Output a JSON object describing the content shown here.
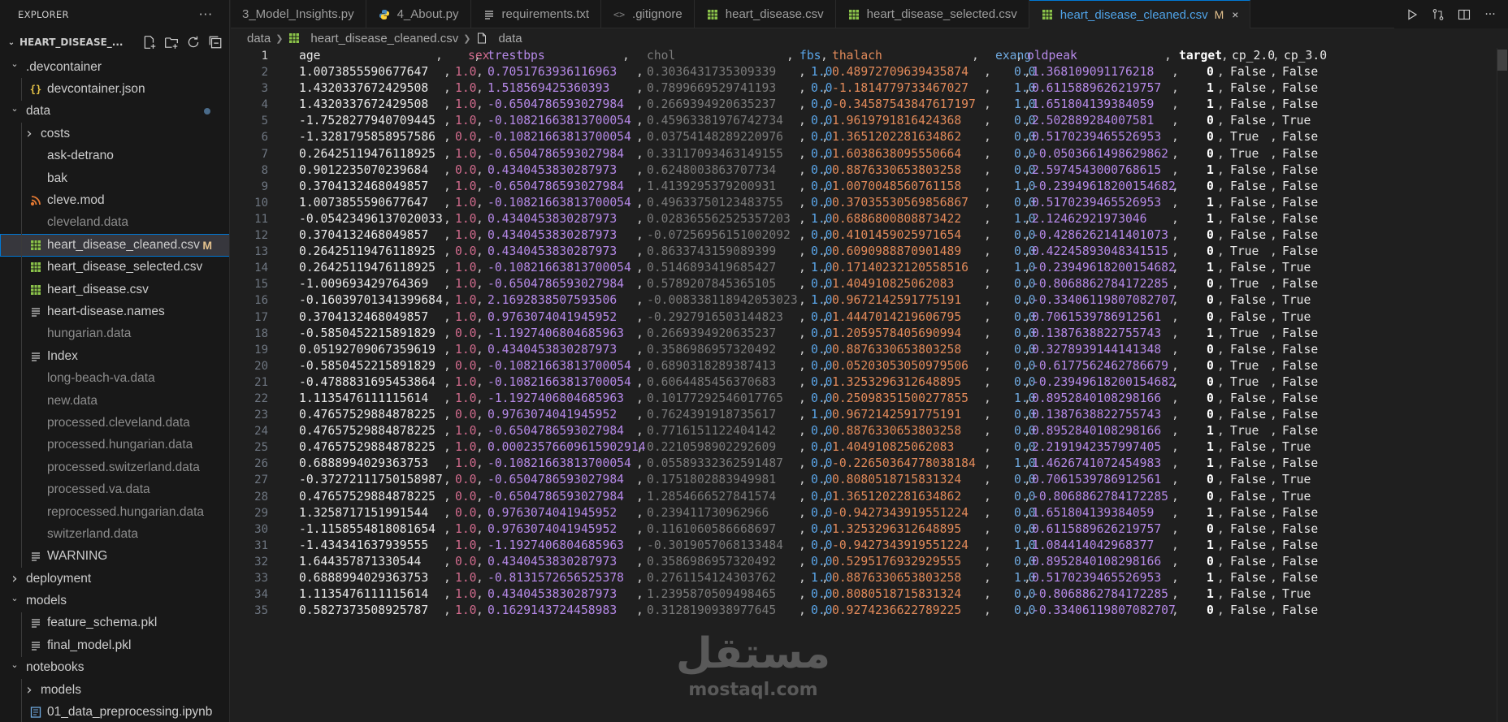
{
  "sidebar": {
    "header": "EXPLORER",
    "more": "···",
    "workspace": "HEART_DISEASE_...",
    "items": [
      {
        "label": ".devcontainer",
        "kind": "folder-open",
        "indent": 1,
        "dim": false
      },
      {
        "label": "devcontainer.json",
        "kind": "json",
        "indent": 2,
        "dim": false
      },
      {
        "label": "data",
        "kind": "folder-open",
        "indent": 1,
        "dim": false,
        "dot": true
      },
      {
        "label": "costs",
        "kind": "folder",
        "indent": 2,
        "dim": false
      },
      {
        "label": "ask-detrano",
        "kind": "file",
        "indent": 2,
        "dim": false
      },
      {
        "label": "bak",
        "kind": "file",
        "indent": 2,
        "dim": false
      },
      {
        "label": "cleve.mod",
        "kind": "rss",
        "indent": 2,
        "dim": false
      },
      {
        "label": "cleveland.data",
        "kind": "file",
        "indent": 2,
        "dim": true
      },
      {
        "label": "heart_disease_cleaned.csv",
        "kind": "csv",
        "indent": 2,
        "dim": false,
        "selected": true,
        "badge": "M"
      },
      {
        "label": "heart_disease_selected.csv",
        "kind": "csv",
        "indent": 2,
        "dim": false
      },
      {
        "label": "heart_disease.csv",
        "kind": "csv",
        "indent": 2,
        "dim": false
      },
      {
        "label": "heart-disease.names",
        "kind": "lines",
        "indent": 2,
        "dim": false
      },
      {
        "label": "hungarian.data",
        "kind": "file",
        "indent": 2,
        "dim": true
      },
      {
        "label": "Index",
        "kind": "lines",
        "indent": 2,
        "dim": false
      },
      {
        "label": "long-beach-va.data",
        "kind": "file",
        "indent": 2,
        "dim": true
      },
      {
        "label": "new.data",
        "kind": "file",
        "indent": 2,
        "dim": true
      },
      {
        "label": "processed.cleveland.data",
        "kind": "file",
        "indent": 2,
        "dim": true
      },
      {
        "label": "processed.hungarian.data",
        "kind": "file",
        "indent": 2,
        "dim": true
      },
      {
        "label": "processed.switzerland.data",
        "kind": "file",
        "indent": 2,
        "dim": true
      },
      {
        "label": "processed.va.data",
        "kind": "file",
        "indent": 2,
        "dim": true
      },
      {
        "label": "reprocessed.hungarian.data",
        "kind": "file",
        "indent": 2,
        "dim": true
      },
      {
        "label": "switzerland.data",
        "kind": "file",
        "indent": 2,
        "dim": true
      },
      {
        "label": "WARNING",
        "kind": "lines",
        "indent": 2,
        "dim": false
      },
      {
        "label": "deployment",
        "kind": "folder",
        "indent": 1,
        "dim": false
      },
      {
        "label": "models",
        "kind": "folder-open",
        "indent": 1,
        "dim": false
      },
      {
        "label": "feature_schema.pkl",
        "kind": "lines",
        "indent": 2,
        "dim": false
      },
      {
        "label": "final_model.pkl",
        "kind": "lines",
        "indent": 2,
        "dim": false
      },
      {
        "label": "notebooks",
        "kind": "folder-open",
        "indent": 1,
        "dim": false
      },
      {
        "label": "models",
        "kind": "folder",
        "indent": 2,
        "dim": false
      },
      {
        "label": "01_data_preprocessing.ipynb",
        "kind": "notebook",
        "indent": 2,
        "dim": false
      }
    ]
  },
  "tabs": [
    {
      "label": "3_Model_Insights.py",
      "kind": "none",
      "active": false
    },
    {
      "label": "4_About.py",
      "kind": "python",
      "active": false
    },
    {
      "label": "requirements.txt",
      "kind": "lines",
      "active": false
    },
    {
      "label": ".gitignore",
      "kind": "git",
      "active": false
    },
    {
      "label": "heart_disease.csv",
      "kind": "csv",
      "active": false
    },
    {
      "label": "heart_disease_selected.csv",
      "kind": "csv",
      "active": false
    },
    {
      "label": "heart_disease_cleaned.csv",
      "kind": "csv",
      "active": true,
      "modified": "M",
      "close": "×"
    }
  ],
  "breadcrumb": {
    "folder": "data",
    "file": "heart_disease_cleaned.csv",
    "symbol": "data"
  },
  "editor": {
    "current_line": 1,
    "header": [
      "age",
      "sex",
      "trestbps",
      "chol",
      "fbs",
      "thalach",
      "exang",
      "oldpeak",
      "target",
      "cp_2.0",
      "cp_3.0"
    ],
    "rows": [
      [
        "1.0073855590677647",
        "1.0",
        "0.7051763936116963",
        "0.3036431735309339",
        "1.0",
        "0.48972709639435874",
        "0.0",
        "1.368109091176218",
        "0",
        "False",
        "False"
      ],
      [
        "1.4320337672429508",
        "1.0",
        "1.518569425360393",
        "0.7899669529741193",
        "0.0",
        "-1.1814779733467027",
        "1.0",
        "0.6115889626219757",
        "1",
        "False",
        "False"
      ],
      [
        "1.4320337672429508",
        "1.0",
        "-0.6504786593027984",
        "0.2669394920635237",
        "0.0",
        "-0.34587543847617197",
        "1.0",
        "1.651804139384059",
        "1",
        "False",
        "False"
      ],
      [
        "-1.7528277940709445",
        "1.0",
        "-0.10821663813700054",
        "0.45963381976742734",
        "0.0",
        "1.9619791816424368",
        "0.0",
        "2.502889284007581",
        "0",
        "False",
        "True"
      ],
      [
        "-1.3281795858957586",
        "0.0",
        "-0.10821663813700054",
        "0.03754148289220976",
        "0.0",
        "1.3651202281634862",
        "0.0",
        "0.5170239465526953",
        "0",
        "True",
        "False"
      ],
      [
        "0.26425119476118925",
        "1.0",
        "-0.6504786593027984",
        "0.33117093463149155",
        "0.0",
        "1.6038638095550664",
        "0.0",
        "-0.0503661498629862",
        "0",
        "True",
        "False"
      ],
      [
        "0.9012235070239684",
        "0.0",
        "0.4340453830287973",
        "0.6248003863707734",
        "0.0",
        "0.8876330653803258",
        "0.0",
        "2.5974543000768615",
        "1",
        "False",
        "False"
      ],
      [
        "0.3704132468049857",
        "1.0",
        "-0.6504786593027984",
        "1.4139295379200931",
        "0.0",
        "1.0070048560761158",
        "1.0",
        "-0.23949618200154682",
        "0",
        "False",
        "False"
      ],
      [
        "1.0073855590677647",
        "1.0",
        "-0.10821663813700054",
        "0.49633750123483755",
        "0.0",
        "0.37035530569856867",
        "0.0",
        "0.5170239465526953",
        "1",
        "False",
        "False"
      ],
      [
        "-0.05423496137020033",
        "1.0",
        "0.4340453830287973",
        "0.028365562525357203",
        "1.0",
        "0.6886800808873422",
        "1.0",
        "2.12462921973046",
        "1",
        "False",
        "False"
      ],
      [
        "0.3704132468049857",
        "1.0",
        "0.4340453830287973",
        "-0.07256956151002092",
        "0.0",
        "0.4101459025971654",
        "0.0",
        "-0.4286262141401073",
        "0",
        "False",
        "False"
      ],
      [
        "0.26425119476118925",
        "0.0",
        "0.4340453830287973",
        "0.8633743159089399",
        "0.0",
        "0.6090988870901489",
        "0.0",
        "0.42245893048341515",
        "0",
        "True",
        "False"
      ],
      [
        "0.26425119476118925",
        "1.0",
        "-0.10821663813700054",
        "0.5146893419685427",
        "1.0",
        "0.17140232120558516",
        "1.0",
        "-0.23949618200154682",
        "1",
        "False",
        "True"
      ],
      [
        "-1.009693429764369",
        "1.0",
        "-0.6504786593027984",
        "0.5789207845365105",
        "0.0",
        "1.404910825062083",
        "0.0",
        "-0.8068862784172285",
        "0",
        "True",
        "False"
      ],
      [
        "-0.16039701341399684",
        "1.0",
        "2.1692838507593506",
        "-0.008338118942053023",
        "1.0",
        "0.9672142591775191",
        "0.0",
        "-0.33406119807082707",
        "0",
        "False",
        "True"
      ],
      [
        "0.3704132468049857",
        "1.0",
        "0.9763074041945952",
        "-0.2927916503144823",
        "0.0",
        "1.4447014219606795",
        "0.0",
        "0.7061539786912561",
        "0",
        "False",
        "True"
      ],
      [
        "-0.5850452215891829",
        "0.0",
        "-1.1927406804685963",
        "0.2669394920635237",
        "0.0",
        "1.2059578405690994",
        "0.0",
        "0.1387638822755743",
        "1",
        "True",
        "False"
      ],
      [
        "0.05192709067359619",
        "1.0",
        "0.4340453830287973",
        "0.3586986957320492",
        "0.0",
        "0.8876330653803258",
        "0.0",
        "0.3278939144141348",
        "0",
        "False",
        "False"
      ],
      [
        "-0.5850452215891829",
        "0.0",
        "-0.10821663813700054",
        "0.6890318289387413",
        "0.0",
        "0.05203053050979506",
        "0.0",
        "-0.6177562462786679",
        "0",
        "True",
        "False"
      ],
      [
        "-0.4788831695453864",
        "1.0",
        "-0.10821663813700054",
        "0.6064485456370683",
        "0.0",
        "1.3253296312648895",
        "0.0",
        "-0.23949618200154682",
        "0",
        "True",
        "False"
      ],
      [
        "1.1135476111115614",
        "1.0",
        "-1.1927406804685963",
        "0.10177292546017765",
        "0.0",
        "0.25098351500277855",
        "1.0",
        "0.8952840108298166",
        "0",
        "False",
        "False"
      ],
      [
        "0.47657529884878225",
        "0.0",
        "0.9763074041945952",
        "0.7624391918735617",
        "1.0",
        "0.9672142591775191",
        "0.0",
        "0.1387638822755743",
        "0",
        "False",
        "False"
      ],
      [
        "0.47657529884878225",
        "1.0",
        "-0.6504786593027984",
        "0.7716151122404142",
        "0.0",
        "0.8876330653803258",
        "0.0",
        "0.8952840108298166",
        "1",
        "True",
        "False"
      ],
      [
        "0.47657529884878225",
        "1.0",
        "0.00023576609615902914",
        "0.2210598902292609",
        "0.0",
        "1.404910825062083",
        "0.0",
        "2.2191942357997405",
        "1",
        "False",
        "True"
      ],
      [
        "0.6888994029363753",
        "1.0",
        "-0.10821663813700054",
        "0.05589332362591487",
        "0.0",
        "-0.22650364778038184",
        "1.0",
        "1.4626741072454983",
        "1",
        "False",
        "False"
      ],
      [
        "-0.37272111750158987",
        "0.0",
        "-0.6504786593027984",
        "0.1751802883949981",
        "0.0",
        "0.8080518715831324",
        "0.0",
        "0.7061539786912561",
        "0",
        "False",
        "True"
      ],
      [
        "0.47657529884878225",
        "0.0",
        "-0.6504786593027984",
        "1.2854666527841574",
        "0.0",
        "1.3651202281634862",
        "0.0",
        "-0.8068862784172285",
        "0",
        "False",
        "True"
      ],
      [
        "1.3258717151991544",
        "0.0",
        "0.9763074041945952",
        "0.239411730962966",
        "0.0",
        "-0.9427343919551224",
        "0.0",
        "1.651804139384059",
        "1",
        "False",
        "False"
      ],
      [
        "-1.1158554818081654",
        "1.0",
        "0.9763074041945952",
        "0.1161060586668697",
        "0.0",
        "1.3253296312648895",
        "0.0",
        "0.6115889626219757",
        "0",
        "False",
        "False"
      ],
      [
        "-1.434341637939555",
        "1.0",
        "-1.1927406804685963",
        "-0.3019057068133484",
        "0.0",
        "-0.9427343919551224",
        "1.0",
        "1.084414042968377",
        "1",
        "False",
        "False"
      ],
      [
        "1.644357871330544",
        "0.0",
        "0.4340453830287973",
        "0.3586986957320492",
        "0.0",
        "0.5295176932929555",
        "0.0",
        "0.8952840108298166",
        "0",
        "False",
        "False"
      ],
      [
        "0.6888994029363753",
        "1.0",
        "-0.8131572656525378",
        "0.2761154124303762",
        "1.0",
        "0.8876330653803258",
        "1.0",
        "0.5170239465526953",
        "1",
        "False",
        "False"
      ],
      [
        "1.1135476111115614",
        "1.0",
        "0.4340453830287973",
        "1.2395870509498465",
        "0.0",
        "0.8080518715831324",
        "0.0",
        "-0.8068862784172285",
        "1",
        "False",
        "True"
      ],
      [
        "0.5827373508925787",
        "1.0",
        "0.1629143724458983",
        "0.3128190938977645",
        "0.0",
        "0.9274236622789225",
        "0.0",
        "-0.33406119807082707",
        "0",
        "False",
        "False"
      ]
    ]
  },
  "watermark": {
    "arabic": "مستقل",
    "latin": "mostaql.com"
  },
  "colors": {
    "accent": "#0078d4",
    "modified": "#e2c08d",
    "csv_icon": "#8bc34a"
  }
}
